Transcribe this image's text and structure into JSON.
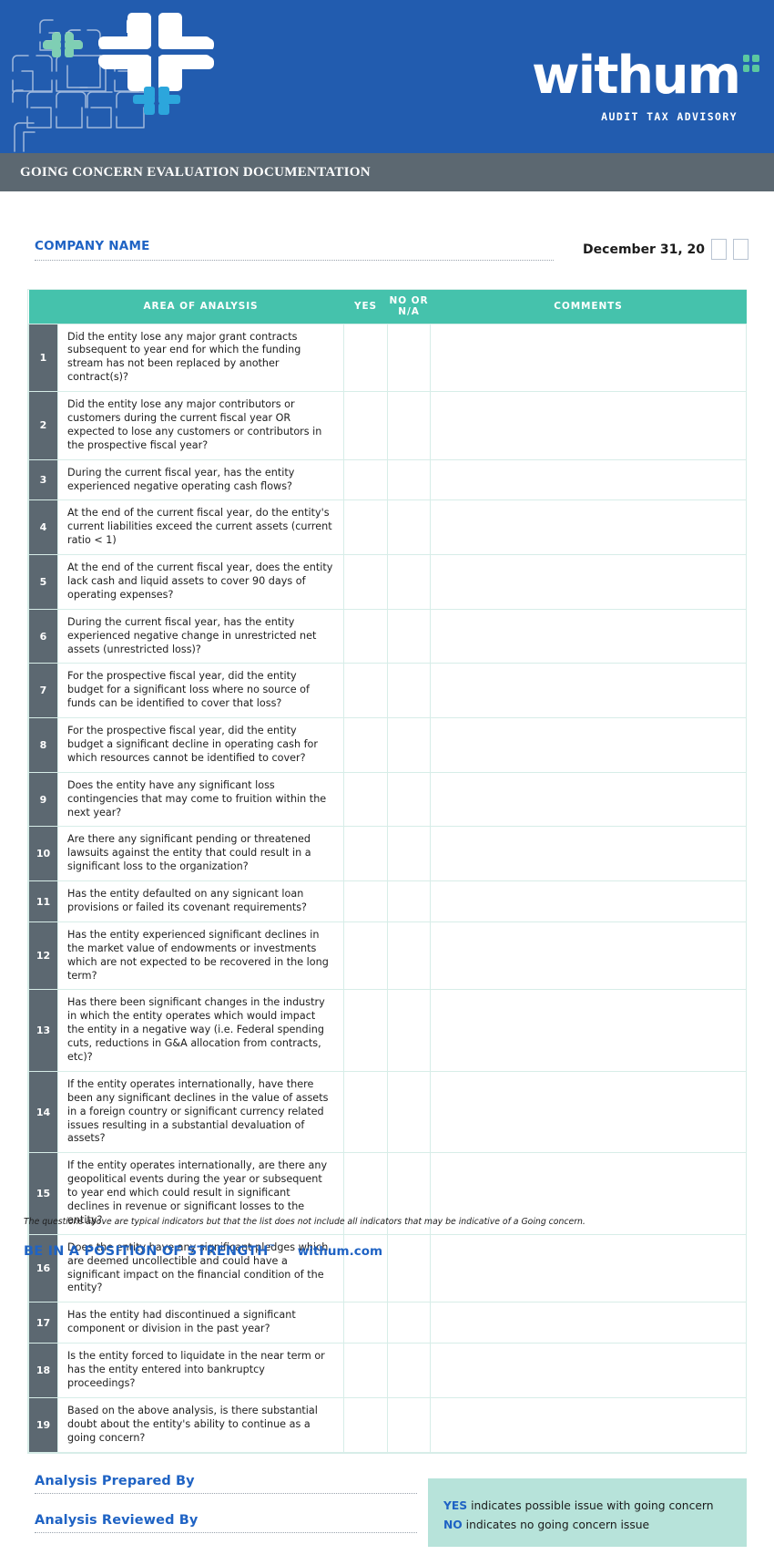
{
  "header": {
    "brand": "withum",
    "brand_tagline": "AUDIT  TAX  ADVISORY",
    "band_color": "#225CAF",
    "accent_green": "#5BC8A0",
    "accent_cyan": "#2CA6DC"
  },
  "title_bar": {
    "text": "GOING CONCERN EVALUATION DOCUMENTATION",
    "background": "#5C6871"
  },
  "meta": {
    "company_label": "COMPANY NAME",
    "company_value": "",
    "company_placeholder": "",
    "date_text": "December 31, 20",
    "year_digit_1": "",
    "year_digit_2": ""
  },
  "table": {
    "header_color": "#45C2AC",
    "number_col_color": "#5C6871",
    "columns": [
      "",
      "AREA OF ANALYSIS",
      "YES",
      "NO OR\nN/A",
      "COMMENTS"
    ],
    "col_area": "AREA OF ANALYSIS",
    "col_yes": "YES",
    "col_no_line1": "NO OR",
    "col_no_line2": "N/A",
    "col_comments": "COMMENTS",
    "rows": [
      {
        "n": "1",
        "q": "Did the entity lose any major grant contracts subsequent to year end for which the funding stream has not been replaced by another contract(s)?",
        "yes": "",
        "no": "",
        "comments": ""
      },
      {
        "n": "2",
        "q": "Did the entity lose any major contributors or customers during the current fiscal year OR expected to lose any customers or contributors in the prospective fiscal year?",
        "yes": "",
        "no": "",
        "comments": ""
      },
      {
        "n": "3",
        "q": "During the current fiscal year, has the entity experienced negative operating cash flows?",
        "yes": "",
        "no": "",
        "comments": ""
      },
      {
        "n": "4",
        "q": "At the end of the current fiscal year, do the entity's current liabilities exceed the current assets (current ratio < 1)",
        "yes": "",
        "no": "",
        "comments": ""
      },
      {
        "n": "5",
        "q": "At the end of the current fiscal year, does the entity lack cash and liquid assets to cover 90 days of operating expenses?",
        "yes": "",
        "no": "",
        "comments": ""
      },
      {
        "n": "6",
        "q": "During the current fiscal year, has the entity experienced negative change in unrestricted net assets (unrestricted loss)?",
        "yes": "",
        "no": "",
        "comments": ""
      },
      {
        "n": "7",
        "q": "For the prospective fiscal year, did the entity budget for a significant loss where no source of funds can be identified to cover that loss?",
        "yes": "",
        "no": "",
        "comments": ""
      },
      {
        "n": "8",
        "q": "For the prospective fiscal year, did the entity budget a significant decline in operating cash for which resources cannot be identified to cover?",
        "yes": "",
        "no": "",
        "comments": ""
      },
      {
        "n": "9",
        "q": "Does the entity have any significant loss contingencies that may come to fruition within the next year?",
        "yes": "",
        "no": "",
        "comments": ""
      },
      {
        "n": "10",
        "q": "Are there any significant pending or threatened lawsuits against the entity that could result in a significant loss to the organization?",
        "yes": "",
        "no": "",
        "comments": ""
      },
      {
        "n": "11",
        "q": "Has the entity defaulted on any signicant loan provisions or failed its covenant requirements?",
        "yes": "",
        "no": "",
        "comments": ""
      },
      {
        "n": "12",
        "q": "Has the entity experienced significant declines in the market value of endowments or investments which are not expected to be recovered in the long term?",
        "yes": "",
        "no": "",
        "comments": ""
      },
      {
        "n": "13",
        "q": "Has there been significant changes in the industry in which the entity operates which would impact the entity in a negative way (i.e. Federal spending cuts, reductions in G&A allocation from contracts, etc)?",
        "yes": "",
        "no": "",
        "comments": ""
      },
      {
        "n": "14",
        "q": "If the entity operates internationally, have there been any significant declines in the value of assets in a foreign country or significant currency related issues resulting in a substantial devaluation of assets?",
        "yes": "",
        "no": "",
        "comments": ""
      },
      {
        "n": "15",
        "q": "If the entity operates internationally, are there any geopolitical events during the year or subsequent to year end which could result in significant declines in revenue or significant losses to the entity?",
        "yes": "",
        "no": "",
        "comments": ""
      },
      {
        "n": "16",
        "q": "Does the entity have any significant pledges which are deemed uncollectible and could have a significant impact on the financial condition of the entity?",
        "yes": "",
        "no": "",
        "comments": ""
      },
      {
        "n": "17",
        "q": "Has the entity had discontinued a significant component or division in the past year?",
        "yes": "",
        "no": "",
        "comments": ""
      },
      {
        "n": "18",
        "q": "Is the entity forced to liquidate in the near term or has the entity entered into bankruptcy proceedings?",
        "yes": "",
        "no": "",
        "comments": ""
      },
      {
        "n": "19",
        "q": "Based on the above analysis, is there substantial doubt about the entity's ability to continue as a going concern?",
        "yes": "",
        "no": "",
        "comments": ""
      }
    ]
  },
  "signatures": {
    "prepared_label": "Analysis Prepared By",
    "prepared_value": "",
    "reviewed_label": "Analysis Reviewed By",
    "reviewed_value": ""
  },
  "legend": {
    "background": "#B7E3DA",
    "yes_key": "YES",
    "yes_text": " indicates possible issue with going concern",
    "no_key": "NO",
    "no_text": " indicates no going concern issue"
  },
  "footer": {
    "disclaimer": "The questions above are typical indicators but that the list does not include all indicators that may be indicative of a Going concern.",
    "tagline": "BE IN A POSITION OF STRENGTH",
    "tagline_mark": "™",
    "website": "withum.com",
    "brand_blue": "#1F63C4"
  }
}
